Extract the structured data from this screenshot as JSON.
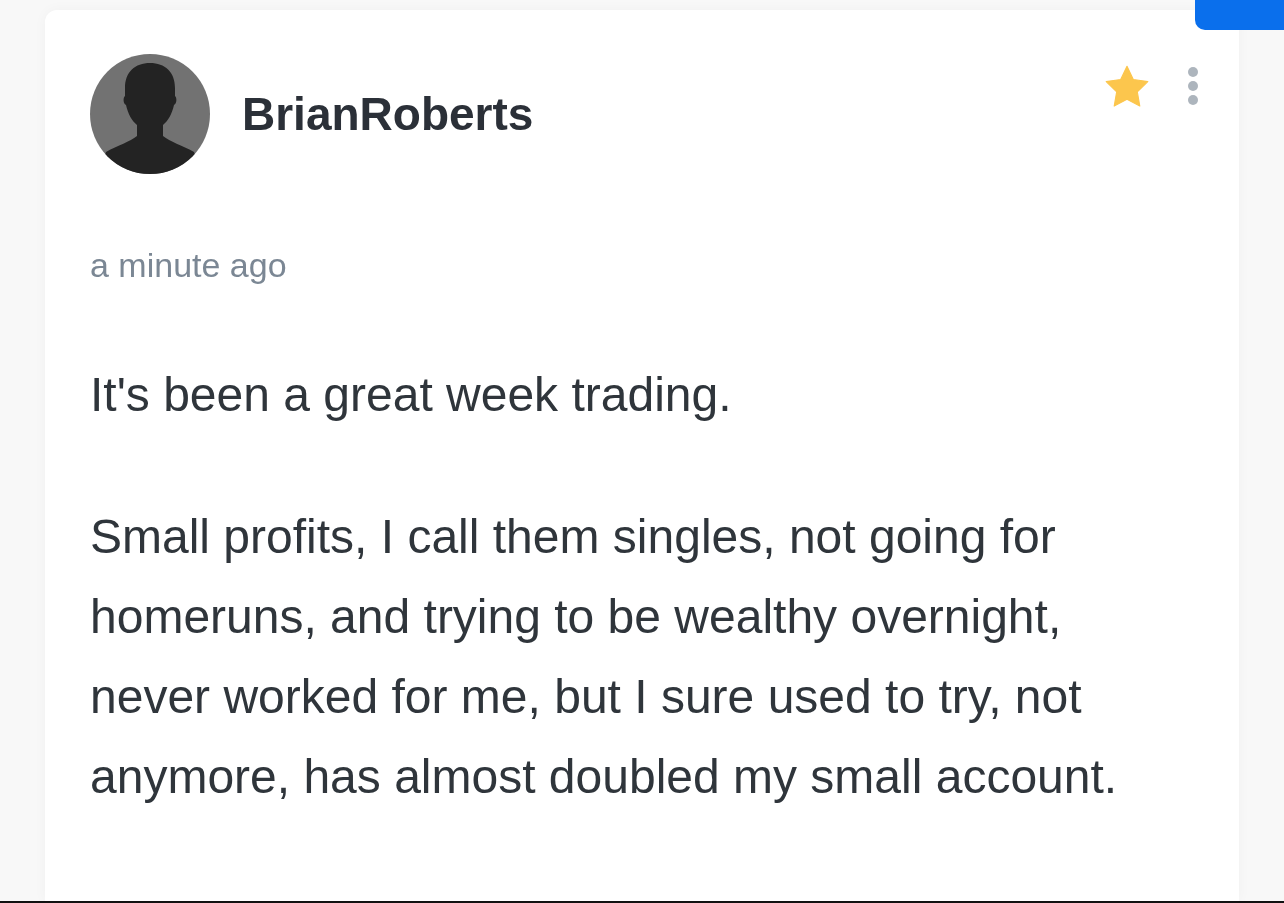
{
  "post": {
    "author": {
      "name": "BrianRoberts"
    },
    "starred": true,
    "timestamp": "a minute ago",
    "body": [
      "It's been a great week trading.",
      "Small profits, I call them singles, not going for homeruns, and trying to be wealthy overnight, never worked for me, but I sure used to try, not anymore, has almost doubled my small account."
    ]
  }
}
